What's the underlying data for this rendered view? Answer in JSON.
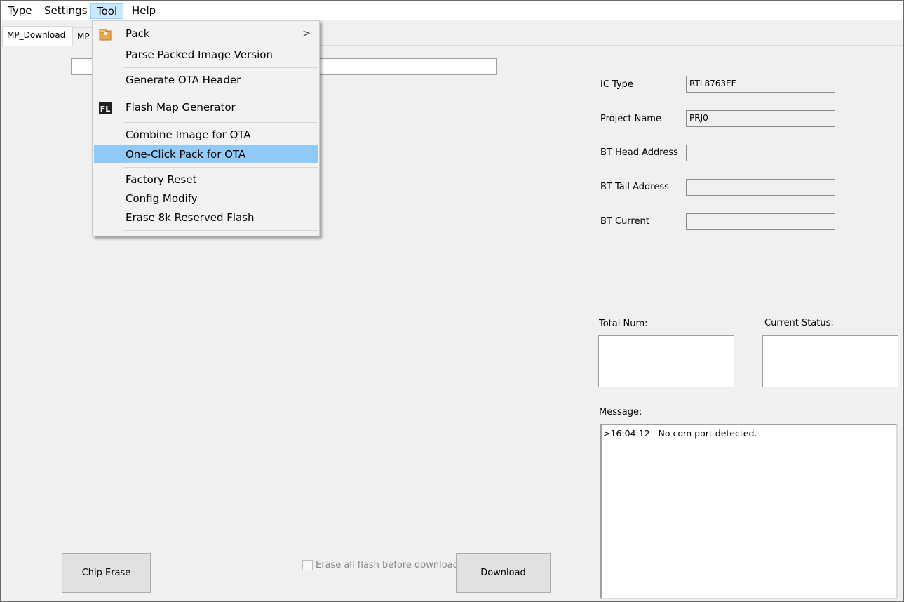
{
  "menubar": {
    "items": [
      "Type",
      "Settings",
      "Tool",
      "Help"
    ],
    "active": "Tool"
  },
  "tabs": [
    "MP_Download",
    "MP_"
  ],
  "tool_menu": {
    "items": [
      {
        "label": "Pack",
        "icon": "package-icon",
        "submenu": true
      },
      {
        "label": "Parse Packed Image Version"
      },
      {
        "label": "Generate OTA Header"
      },
      {
        "label": "Flash Map Generator",
        "icon": "fl-icon"
      },
      {
        "label": "Combine Image for OTA"
      },
      {
        "label": "One-Click Pack for OTA",
        "highlighted": true
      },
      {
        "label": "Factory Reset"
      },
      {
        "label": "Config Modify"
      },
      {
        "label": "Erase 8k Reserved Flash"
      }
    ],
    "submenu_arrow": ">"
  },
  "info": {
    "ic_type_label": "IC Type",
    "ic_type_value": "RTL8763EF",
    "project_name_label": "Project Name",
    "project_name_value": "PRJ0",
    "bt_head_label": "BT Head Address",
    "bt_head_value": "",
    "bt_tail_label": "BT Tail Address",
    "bt_tail_value": "",
    "bt_current_label": "BT Current",
    "bt_current_value": ""
  },
  "status": {
    "total_num_label": "Total Num:",
    "current_status_label": "Current Status:",
    "message_label": "Message:",
    "message_text": ">16:04:12   No com port detected."
  },
  "actions": {
    "chip_erase": "Chip Erase",
    "erase_all_label": "Erase all flash before download",
    "download": "Download"
  },
  "colors": {
    "menu_highlight": "#91c9f7",
    "menubar_active": "#cce8ff"
  }
}
